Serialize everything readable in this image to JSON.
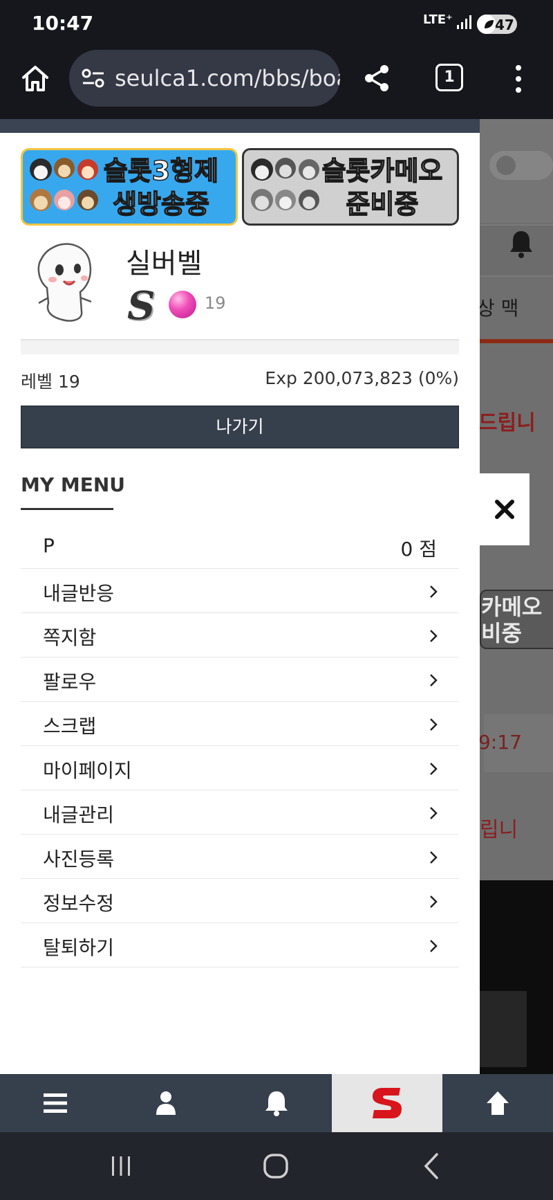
{
  "status_bar": {
    "time": "10:47",
    "network": "LTE⁺",
    "battery": "47",
    "battery_level_percent": 47
  },
  "browser": {
    "url": "seulca1.com/bbs/boa",
    "tab_count": "1"
  },
  "drawer": {
    "banners": [
      {
        "text_line1": "슬롯3형제",
        "text_line2": "생방송중",
        "color": "#38a8ee"
      },
      {
        "text_line1": "슬롯카메오",
        "text_line2": "준비중",
        "color": "#d0d0d0"
      }
    ],
    "profile": {
      "nickname": "실버벨",
      "grade_letter": "S",
      "level_number": "19"
    },
    "exp_progress_percent": 0,
    "level_label": "레벨 19",
    "exp_label": "Exp 200,073,823 (0%)",
    "logout_label": "나가기",
    "my_menu_title": "MY MENU",
    "points": {
      "label": "P",
      "value": "0 점"
    },
    "menu_items": [
      {
        "label": "내글반응"
      },
      {
        "label": "쪽지함"
      },
      {
        "label": "팔로우"
      },
      {
        "label": "스크랩"
      },
      {
        "label": "마이페이지"
      },
      {
        "label": "내글관리"
      },
      {
        "label": "사진등록"
      },
      {
        "label": "정보수정"
      },
      {
        "label": "탈퇴하기"
      }
    ]
  },
  "background_page": {
    "text_fragment_1": "상    맥",
    "red_fragment_1": "드립니",
    "banner_fragment_line1": "카메오",
    "banner_fragment_line2": "비중",
    "time_fragment": "9:17",
    "red_fragment_2": "립니"
  },
  "bottom_nav": {
    "items": [
      "menu-icon",
      "user-icon",
      "bell-icon",
      "site-logo",
      "arrow-up-icon"
    ]
  },
  "colors": {
    "drawer_header": "#3a4452",
    "nav_bar": "#363f4c",
    "accent_red": "#c8102e"
  }
}
